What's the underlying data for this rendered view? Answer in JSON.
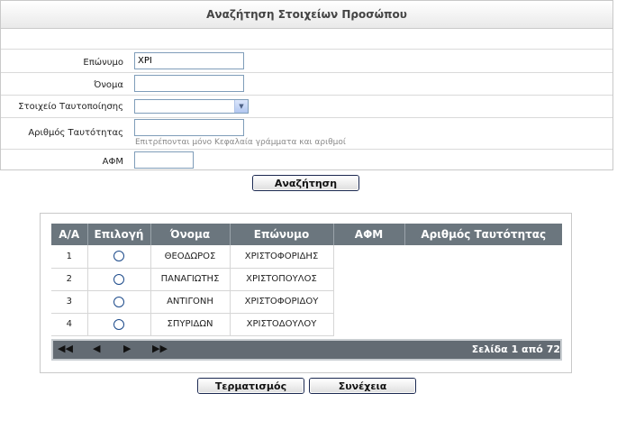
{
  "form": {
    "title": "Αναζήτηση Στοιχείων Προσώπου",
    "surname_label": "Επώνυμο",
    "surname_value": "ΧΡΙ",
    "name_label": "Όνομα",
    "name_value": "",
    "id_type_label": "Στοιχείο Ταυτοποίησης",
    "id_type_value": "",
    "id_number_label": "Αριθμός Ταυτότητας",
    "id_number_value": "",
    "id_number_hint": "Επιτρέπονται μόνο Κεφαλαία γράμματα και αριθμοί",
    "afm_label": "ΑΦΜ",
    "afm_value": "",
    "search_button": "Αναζήτηση"
  },
  "results": {
    "columns": [
      "Α/Α",
      "Επιλογή",
      "Όνομα",
      "Επώνυμο",
      "ΑΦΜ",
      "Αριθμός Ταυτότητας"
    ],
    "rows": [
      {
        "aa": "1",
        "name": "ΘΕΟΔΩΡΟΣ",
        "surname": "ΧΡΙΣΤΟΦΟΡΙΔΗΣ"
      },
      {
        "aa": "2",
        "name": "ΠΑΝΑΓΙΩΤΗΣ",
        "surname": "ΧΡΙΣΤΟΠΟΥΛΟΣ"
      },
      {
        "aa": "3",
        "name": "ΑΝΤΙΓΟΝΗ",
        "surname": "ΧΡΙΣΤΟΦΟΡΙΔΟΥ"
      },
      {
        "aa": "4",
        "name": "ΣΠΥΡΙΔΩΝ",
        "surname": "ΧΡΙΣΤΟΔΟΥΛΟΥ"
      }
    ],
    "pager": {
      "first": "◀◀",
      "prev": "◀",
      "next": "▶",
      "last": "▶▶",
      "page_info": "Σελίδα 1 από 72"
    }
  },
  "actions": {
    "terminate_button": "Τερματισμός",
    "continue_button": "Συνέχεια"
  },
  "colors": {
    "header_bg": "#6b767e",
    "pager_bg": "#636b73",
    "input_border": "#7f9db9",
    "button_border": "#1c2a52"
  }
}
